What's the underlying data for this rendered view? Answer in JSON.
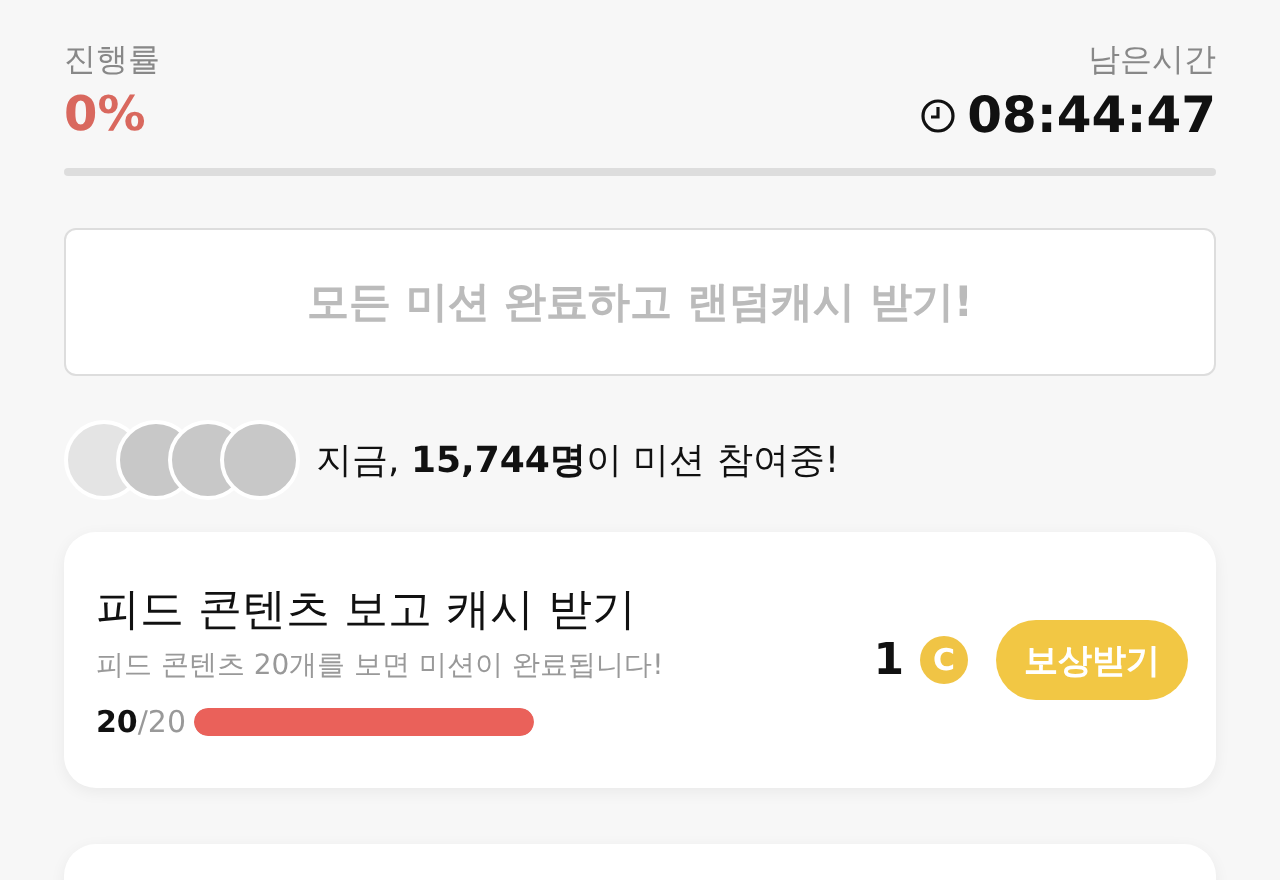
{
  "progress": {
    "label": "진행률",
    "value": "0%",
    "level": 0
  },
  "timer": {
    "label": "남은시간",
    "value": "08:44:47"
  },
  "banner": {
    "text": "모든 미션 완료하고 랜덤캐시 받기!",
    "disabled": true
  },
  "participants": {
    "text": "지금, **15,744명**이 미션 참여중!"
  },
  "missions": [
    {
      "title": "피드 콘텐츠 보고 캐시 받기",
      "description": "피드 콘텐츠 20개를 보면 미션이 완료됩니다!",
      "current": "20",
      "total": "/20",
      "level": 1,
      "reward": "1",
      "coin_label": "C",
      "button": "보상받기"
    }
  ]
}
